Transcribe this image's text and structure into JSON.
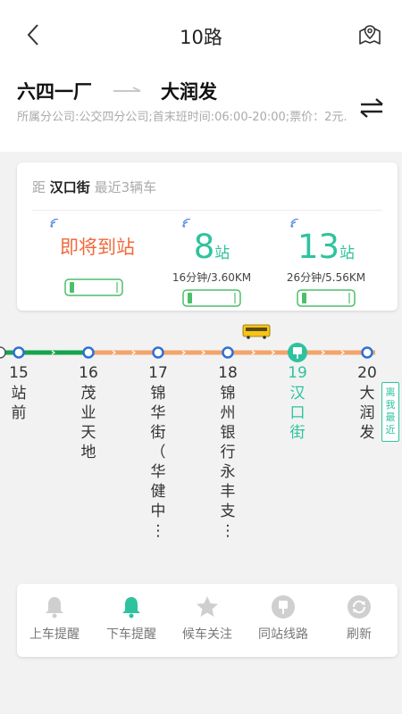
{
  "header": {
    "title": "10路",
    "back_icon": "chevron-left-icon",
    "map_icon": "map-pin-icon"
  },
  "route": {
    "from": "六四一厂",
    "to": "大润发",
    "description": "所属分公司:公交四分公司;首末班时间:06:00-20:00;票价：2元."
  },
  "bus_card": {
    "prefix": "距",
    "stop_name": "汉口街",
    "suffix": "最近3辆车",
    "buses": [
      {
        "main_text": "即将到站",
        "sub": ""
      },
      {
        "count": "8",
        "unit": "站",
        "sub": "16分钟/3.60KM"
      },
      {
        "count": "13",
        "unit": "站",
        "sub": "26分钟/5.56KM"
      }
    ]
  },
  "stations": [
    {
      "num": "15",
      "name": "站\n前"
    },
    {
      "num": "16",
      "name": "茂\n业\n天\n地"
    },
    {
      "num": "17",
      "name": "锦\n华\n街\n（\n华\n健\n中\n⋮"
    },
    {
      "num": "18",
      "name": "锦\n州\n银\n行\n永\n丰\n支\n⋮"
    },
    {
      "num": "19",
      "name": "汉\n口\n街"
    },
    {
      "num": "20",
      "name": "大\n润\n发"
    }
  ],
  "near_tag": "离我最近",
  "toolbar": {
    "items": [
      {
        "label": "上车提醒",
        "icon": "bell-icon"
      },
      {
        "label": "下车提醒",
        "icon": "bell-active-icon"
      },
      {
        "label": "候车关注",
        "icon": "star-icon"
      },
      {
        "label": "同站线路",
        "icon": "bus-stop-icon"
      },
      {
        "label": "刷新",
        "icon": "refresh-icon"
      }
    ]
  },
  "colors": {
    "accent": "#2ec39e",
    "arriving": "#f06a3c",
    "line_traveled": "#17a34a",
    "line_upcoming": "#f3a46a",
    "station_ring": "#2e6fd8"
  }
}
